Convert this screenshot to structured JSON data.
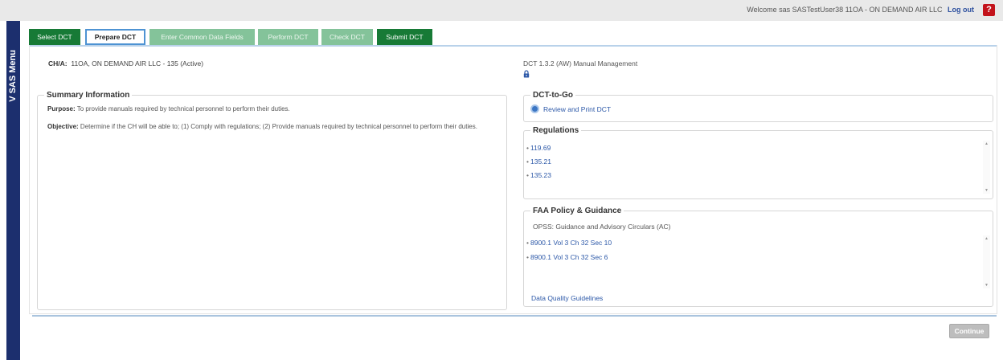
{
  "header": {
    "welcome_text": "Welcome sas SASTestUser38 11OA - ON DEMAND AIR LLC",
    "logout_label": "Log out",
    "help_label": "?"
  },
  "side_menu": {
    "label": "V SAS Menu"
  },
  "tabs": [
    {
      "label": "Select DCT",
      "state": "enabled"
    },
    {
      "label": "Prepare DCT",
      "state": "active"
    },
    {
      "label": "Enter Common Data Fields",
      "state": "disabled"
    },
    {
      "label": "Perform DCT",
      "state": "disabled"
    },
    {
      "label": "Check DCT",
      "state": "disabled"
    },
    {
      "label": "Submit DCT",
      "state": "enabled"
    }
  ],
  "cha": {
    "label": "CH/A:",
    "value": "11OA, ON DEMAND AIR LLC - 135 (Active)"
  },
  "dct": {
    "title": "DCT 1.3.2 (AW) Manual Management",
    "lock_icon": "lock-icon"
  },
  "summary": {
    "legend": "Summary Information",
    "purpose_label": "Purpose:",
    "purpose_text": "To provide manuals required by technical personnel to perform their duties.",
    "objective_label": "Objective:",
    "objective_text": "Determine if the CH will be able to; (1) Comply with regulations; (2) Provide manuals required by technical personnel to perform their duties."
  },
  "dct_to_go": {
    "legend": "DCT-to-Go",
    "link_label": "Review and Print DCT"
  },
  "regulations": {
    "legend": "Regulations",
    "items": [
      "119.69",
      "135.21",
      "135.23"
    ]
  },
  "faa_policy": {
    "legend": "FAA Policy & Guidance",
    "subheading": "OPSS: Guidance and Advisory Circulars (AC)",
    "items": [
      "8900.1 Vol 3 Ch 32 Sec 10",
      "8900.1 Vol 3 Ch 32 Sec 6"
    ],
    "data_quality_link": "Data Quality Guidelines"
  },
  "actions": {
    "continue_label": "Continue",
    "continue_enabled": false
  },
  "colors": {
    "tab_green": "#177a36",
    "tab_disabled": "#84c39a",
    "active_tab_border": "#4e93d3",
    "side_menu": "#1c2f6e",
    "link": "#2c58a8",
    "help": "#c3131b"
  }
}
